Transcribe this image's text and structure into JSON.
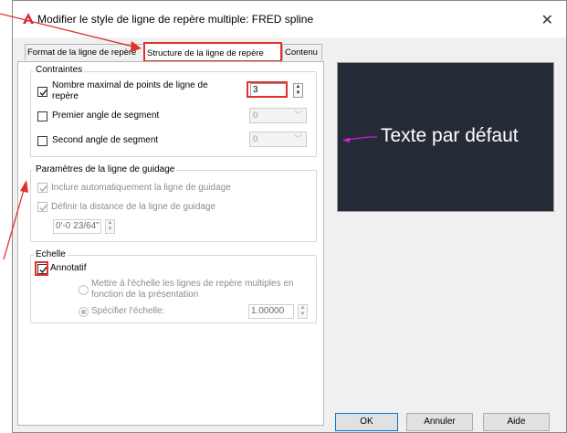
{
  "window": {
    "title": "Modifier le style de ligne de repère multiple: FRED spline",
    "close_glyph": "✕"
  },
  "tabs": [
    {
      "label": "Format de la ligne de repère",
      "active": false
    },
    {
      "label": "Structure de la ligne de repère",
      "active": true
    },
    {
      "label": "Contenu",
      "active": false
    }
  ],
  "constraints": {
    "title": "Contraintes",
    "max_points": {
      "label_line1": "Nombre maximal de points de ligne de",
      "label_line2": "repère",
      "checked": true,
      "value": "3"
    },
    "first_angle": {
      "label": "Premier angle de segment",
      "checked": false,
      "value": "0"
    },
    "second_angle": {
      "label": "Second angle de segment",
      "checked": false,
      "value": "0"
    }
  },
  "landing": {
    "title": "Paramètres de la ligne de guidage",
    "auto_include": {
      "label": "Inclure automatiquement la ligne de guidage",
      "checked": true
    },
    "set_distance": {
      "label": "Définir la distance de la ligne de guidage",
      "checked": true
    },
    "distance_value": "0'-0 23/64\""
  },
  "scale": {
    "title": "Echelle",
    "annotative": {
      "label": "Annotatif",
      "checked": true
    },
    "scale_to_layout": {
      "label_line1": "Mettre à l'échelle les lignes de repère multiples en",
      "label_line2": "fonction de la présentation",
      "selected": false
    },
    "specify_scale": {
      "label": "Spécifier l'échelle:",
      "selected": true,
      "value": "1.00000"
    }
  },
  "preview": {
    "text": "Texte par défaut",
    "leader_color": "#d31fd1",
    "background": "#252b36"
  },
  "buttons": {
    "ok": "OK",
    "cancel": "Annuler",
    "help": "Aide"
  },
  "colors": {
    "accent_red": "#e0312b",
    "ok_border": "#0078d7"
  },
  "icons": {
    "app": "autocad-icon",
    "spin": "spinner-icon",
    "combo": "chevron-down-icon"
  }
}
